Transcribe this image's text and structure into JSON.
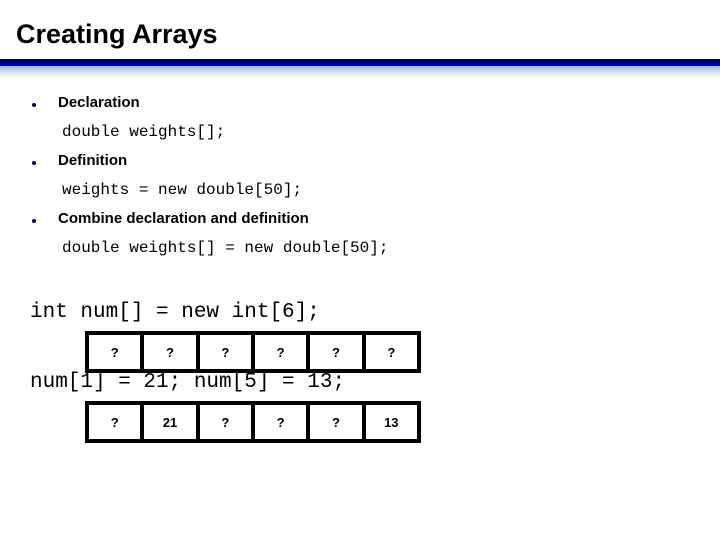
{
  "slide": {
    "title": "Creating Arrays"
  },
  "bullets": [
    {
      "label": "Declaration",
      "code": "double weights[];"
    },
    {
      "label": "Definition",
      "code": "weights = new double[50];"
    },
    {
      "label": "Combine declaration and definition",
      "code": "double weights[] = new double[50];"
    }
  ],
  "arrays": [
    {
      "code": "int num[] = new int[6];",
      "cells": [
        "?",
        "?",
        "?",
        "?",
        "?",
        "?"
      ]
    },
    {
      "code": "num[1] = 21; num[5] = 13;",
      "cells": [
        "?",
        "21",
        "?",
        "?",
        "?",
        "13"
      ]
    }
  ],
  "colors": {
    "title_text": "#000000",
    "bullet_dot": "#000066",
    "rule_dark": "#000033",
    "rule_blue": "#0000cc",
    "cell_border": "#000000",
    "background": "#ffffff"
  }
}
